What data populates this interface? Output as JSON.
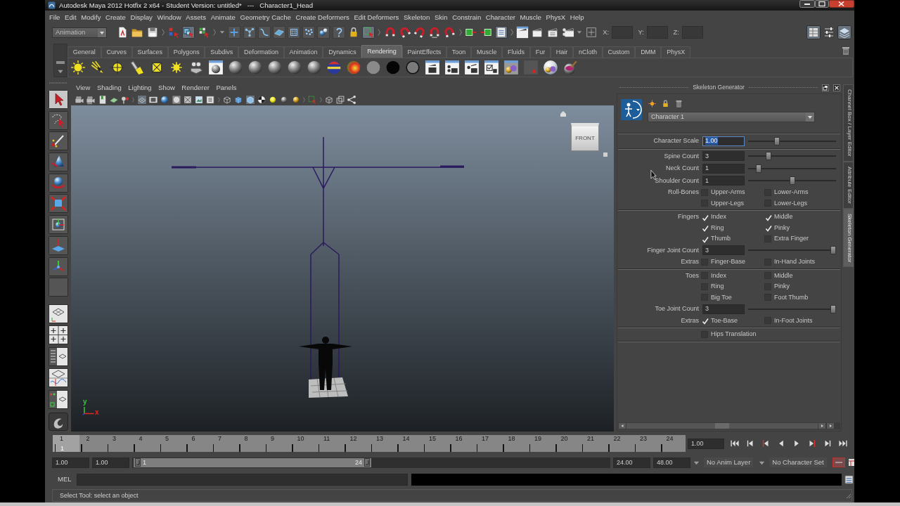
{
  "window": {
    "title": "Autodesk Maya 2012 Hotfix 2 x64 - Student Version: untitled*   ---   Character1_Head"
  },
  "menu_bar": [
    "File",
    "Edit",
    "Modify",
    "Create",
    "Display",
    "Window",
    "Assets",
    "Animate",
    "Geometry Cache",
    "Create Deformers",
    "Edit Deformers",
    "Skeleton",
    "Skin",
    "Constrain",
    "Character",
    "Muscle",
    "PhysX",
    "Help"
  ],
  "status_line": {
    "menu_set": "Animation",
    "coordinates": [
      "X:",
      "Y:",
      "Z:"
    ]
  },
  "shelf": {
    "tabs": [
      {
        "label": "General",
        "selected": false
      },
      {
        "label": "Curves",
        "selected": false
      },
      {
        "label": "Surfaces",
        "selected": false
      },
      {
        "label": "Polygons",
        "selected": false
      },
      {
        "label": "Subdivs",
        "selected": false
      },
      {
        "label": "Deformation",
        "selected": false
      },
      {
        "label": "Animation",
        "selected": false
      },
      {
        "label": "Dynamics",
        "selected": false
      },
      {
        "label": "Rendering",
        "selected": true
      },
      {
        "label": "PaintEffects",
        "selected": false
      },
      {
        "label": "Toon",
        "selected": false
      },
      {
        "label": "Muscle",
        "selected": false
      },
      {
        "label": "Fluids",
        "selected": false
      },
      {
        "label": "Fur",
        "selected": false
      },
      {
        "label": "Hair",
        "selected": false
      },
      {
        "label": "nCloth",
        "selected": false
      },
      {
        "label": "Custom",
        "selected": false
      },
      {
        "label": "DMM",
        "selected": false
      },
      {
        "label": "PhysX",
        "selected": false
      }
    ]
  },
  "toolbox": {
    "tools": [
      {
        "selected": true
      },
      {
        "selected": false
      },
      {
        "selected": false
      },
      {
        "selected": false
      },
      {
        "selected": false
      },
      {
        "selected": false
      },
      {
        "selected": false
      },
      {
        "selected": false
      },
      {
        "selected": false
      },
      {
        "selected": false
      }
    ]
  },
  "viewport": {
    "menus": [
      "View",
      "Shading",
      "Lighting",
      "Show",
      "Renderer",
      "Panels"
    ],
    "view_cube": "FRONT",
    "axes": [
      {
        "label": "y",
        "color": "#3cc83c"
      },
      {
        "label": "x",
        "color": "#e02828"
      }
    ]
  },
  "skeleton_generator": {
    "title": "Skeleton Generator",
    "character": "Character 1",
    "sections": [
      {
        "rows": [
          {
            "kind": "slider",
            "label": "Character Scale",
            "value": "1.00",
            "level": 0.32,
            "focused": true
          }
        ]
      },
      {
        "rows": [
          {
            "kind": "slider",
            "label": "Spine Count",
            "value": "3",
            "level": 0.21,
            "focused": false
          },
          {
            "kind": "slider",
            "label": "Neck Count",
            "value": "1",
            "level": 0.09,
            "focused": false
          },
          {
            "kind": "slider",
            "label": "Shoulder Count",
            "value": "1",
            "level": 0.5,
            "focused": false
          },
          {
            "kind": "checks",
            "label": "Roll-Bones",
            "items": [
              {
                "label": "Upper-Arms",
                "checked": false
              },
              {
                "label": "Lower-Arms",
                "checked": false
              },
              {
                "label": "Upper-Legs",
                "checked": false
              },
              {
                "label": "Lower-Legs",
                "checked": false
              }
            ]
          }
        ]
      },
      {
        "rows": [
          {
            "kind": "checks",
            "label": "Fingers",
            "items": [
              {
                "label": "Index",
                "checked": true
              },
              {
                "label": "Middle",
                "checked": true
              },
              {
                "label": "Ring",
                "checked": true
              },
              {
                "label": "Pinky",
                "checked": true
              },
              {
                "label": "Thumb",
                "checked": true
              },
              {
                "label": "Extra Finger",
                "checked": false
              }
            ]
          },
          {
            "kind": "slider",
            "label": "Finger Joint Count",
            "value": "3",
            "level": 1,
            "focused": false
          },
          {
            "kind": "checks",
            "label": "Extras",
            "items": [
              {
                "label": "Finger-Base",
                "checked": false
              },
              {
                "label": "In-Hand Joints",
                "checked": false
              }
            ]
          }
        ]
      },
      {
        "rows": [
          {
            "kind": "checks",
            "label": "Toes",
            "items": [
              {
                "label": "Index",
                "checked": false
              },
              {
                "label": "Middle",
                "checked": false
              },
              {
                "label": "Ring",
                "checked": false
              },
              {
                "label": "Pinky",
                "checked": false
              },
              {
                "label": "Big Toe",
                "checked": false
              },
              {
                "label": "Foot Thumb",
                "checked": false
              }
            ]
          },
          {
            "kind": "slider",
            "label": "Toe Joint Count",
            "value": "3",
            "level": 1,
            "focused": false
          },
          {
            "kind": "checks",
            "label": "Extras",
            "items": [
              {
                "label": "Toe-Base",
                "checked": true
              },
              {
                "label": "In-Foot Joints",
                "checked": false
              }
            ]
          }
        ]
      },
      {
        "rows": [
          {
            "kind": "checks",
            "items": [
              {
                "label": "Hips Translation",
                "checked": false
              }
            ]
          }
        ]
      }
    ]
  },
  "side_tabs": [
    {
      "label": "Channel Box / Layer Editor",
      "selected": false
    },
    {
      "label": "Attribute Editor",
      "selected": false
    },
    {
      "label": "Skeleton Generator",
      "selected": true
    }
  ],
  "time_slider": {
    "frames": [
      {
        "label": "1",
        "selected": true
      },
      {
        "label": "2",
        "selected": false
      },
      {
        "label": "3",
        "selected": false
      },
      {
        "label": "4",
        "selected": false
      },
      {
        "label": "5",
        "selected": false
      },
      {
        "label": "6",
        "selected": false
      },
      {
        "label": "7",
        "selected": false
      },
      {
        "label": "8",
        "selected": false
      },
      {
        "label": "9",
        "selected": false
      },
      {
        "label": "10",
        "selected": false
      },
      {
        "label": "11",
        "selected": false
      },
      {
        "label": "12",
        "selected": false
      },
      {
        "label": "13",
        "selected": false
      },
      {
        "label": "14",
        "selected": false
      },
      {
        "label": "15",
        "selected": false
      },
      {
        "label": "16",
        "selected": false
      },
      {
        "label": "17",
        "selected": false
      },
      {
        "label": "18",
        "selected": false
      },
      {
        "label": "19",
        "selected": false
      },
      {
        "label": "20",
        "selected": false
      },
      {
        "label": "21",
        "selected": false
      },
      {
        "label": "22",
        "selected": false
      },
      {
        "label": "23",
        "selected": false
      },
      {
        "label": "24",
        "selected": false
      }
    ],
    "current_frame": "1",
    "current_time": "1.00"
  },
  "range_slider": {
    "start_time": "1.00",
    "playback_start": "1.00",
    "range_start": "1",
    "range_end": "24",
    "level": 0.5,
    "playback_end": "24.00",
    "end_time": "48.00",
    "anim_layer": "No Anim Layer",
    "character_set": "No Character Set"
  },
  "command_line": {
    "language": "MEL"
  },
  "help_line": "Select Tool: select an object"
}
